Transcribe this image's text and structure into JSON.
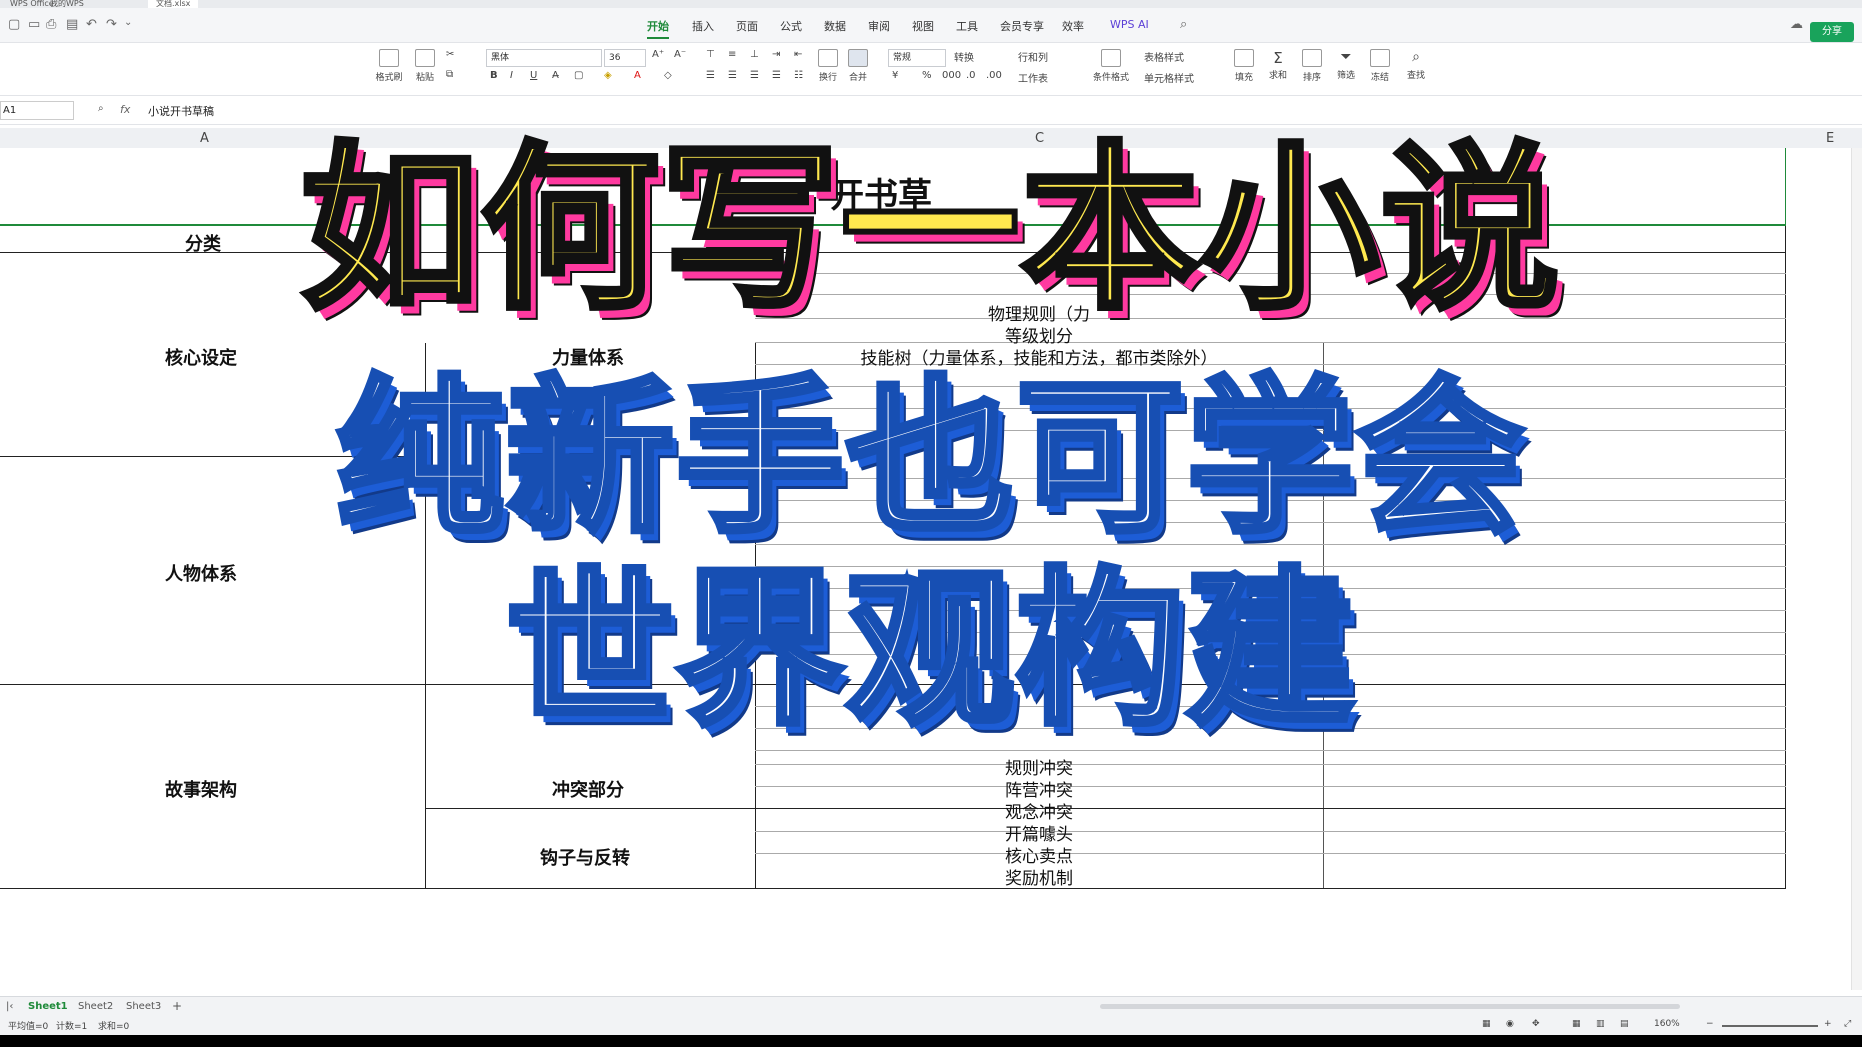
{
  "window": {
    "tabs": [
      "WPS Office",
      "我的WPS",
      "文档.xlsx"
    ]
  },
  "menu": {
    "items": [
      "开始",
      "插入",
      "页面",
      "公式",
      "数据",
      "审阅",
      "视图",
      "工具",
      "会员专享",
      "效率",
      "WPS AI"
    ],
    "active": "开始",
    "share_label": "分享"
  },
  "ribbon": {
    "format_painter": "格式刷",
    "paste": "粘贴",
    "font_name": "黑体",
    "font_size": "36",
    "wrap": "换行",
    "merge": "合并",
    "number_format": "常规",
    "convert": "转换",
    "rows_cols": "行和列",
    "worksheet": "工作表",
    "conditional_format": "条件格式",
    "table_style": "表格样式",
    "cell_style": "单元格样式",
    "fill": "填充",
    "sum": "求和",
    "sort": "排序",
    "filter": "筛选",
    "freeze": "冻结",
    "find": "查找"
  },
  "formula_bar": {
    "cell_ref": "A1",
    "content": "小说开书草稿"
  },
  "columns": [
    "A",
    "C",
    "E"
  ],
  "sheet": {
    "title_fragment": "开书草",
    "col_a_header": "分类",
    "categories": [
      "核心设定",
      "人物体系",
      "故事架构"
    ],
    "col_b_items": [
      "力量体系",
      "冲突部分",
      "钩子与反转"
    ],
    "col_c_items": [
      "物理规则（力",
      "等级划分",
      "技能树（力量体系，技能和方法，都市类除外）",
      "规则冲突",
      "阵营冲突",
      "观念冲突",
      "开篇噱头",
      "核心卖点",
      "奖励机制"
    ]
  },
  "sheet_tabs": [
    "Sheet1",
    "Sheet2",
    "Sheet3"
  ],
  "active_sheet": "Sheet1",
  "status": {
    "average": "平均值=0",
    "count": "计数=1",
    "sum": "求和=0",
    "zoom": "160%"
  },
  "overlay": {
    "line1": "如何写一本小说",
    "line2": "纯新手也可学会",
    "line3": "世界观构建"
  }
}
